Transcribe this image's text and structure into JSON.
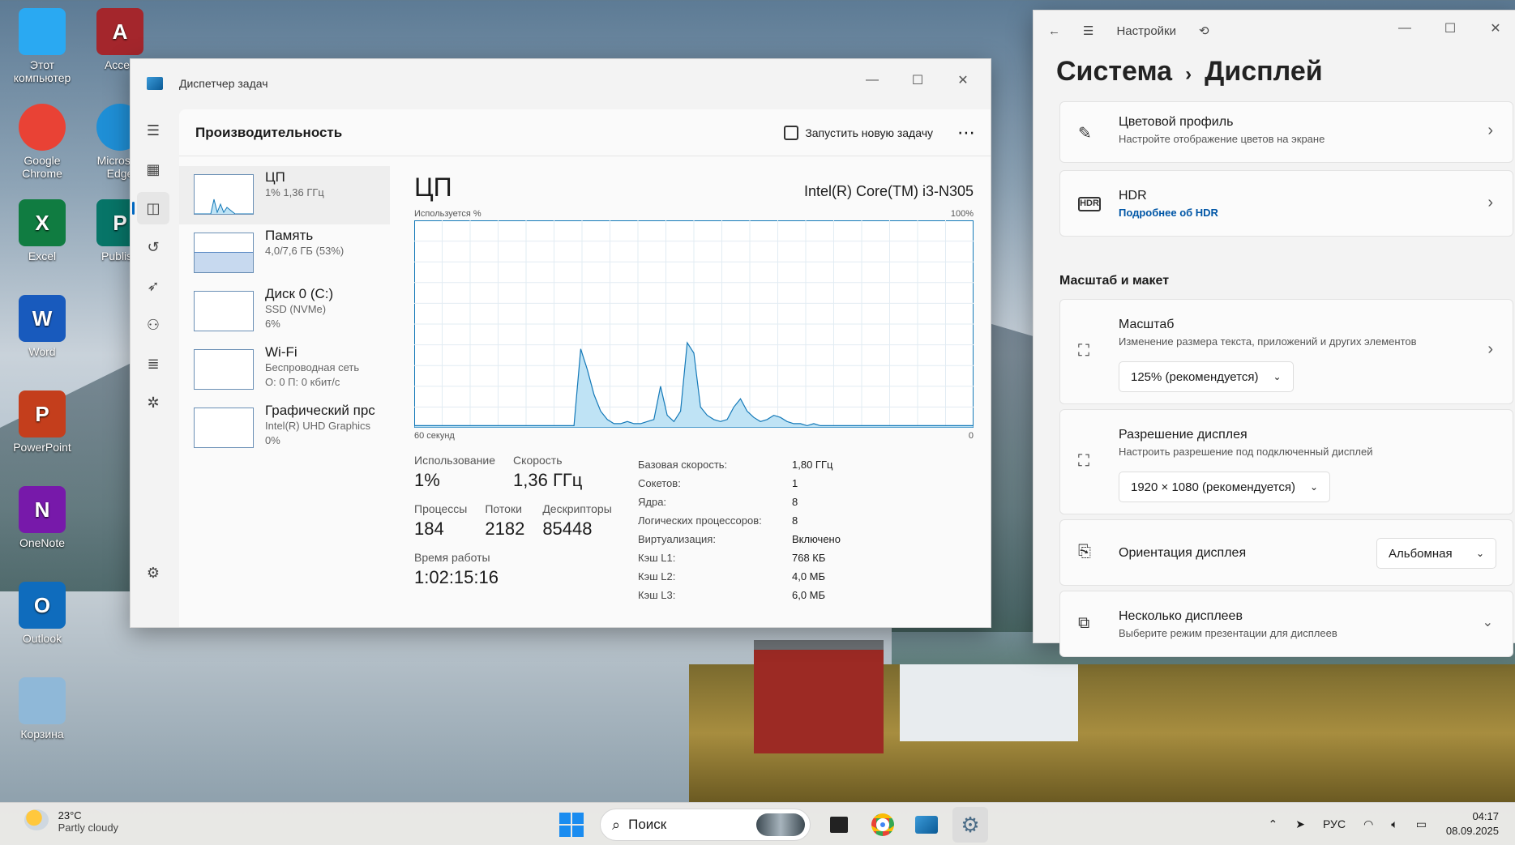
{
  "desktop": {
    "icons": [
      {
        "label": "Этот компьютер",
        "icon": "computer-icon",
        "color": "#2aa9f2"
      },
      {
        "label": "Acces",
        "icon": "access-icon",
        "color": "#a4262c"
      },
      {
        "label": "Google Chrome",
        "icon": "chrome-icon",
        "color": "#e94235"
      },
      {
        "label": "Microsoft Edge",
        "icon": "edge-icon",
        "color": "#1f8fd6"
      },
      {
        "label": "Excel",
        "icon": "excel-icon",
        "color": "#107c41"
      },
      {
        "label": "Publish",
        "icon": "publisher-icon",
        "color": "#077568"
      },
      {
        "label": "Word",
        "icon": "word-icon",
        "color": "#185abd"
      },
      {
        "label": "PowerPoint",
        "icon": "powerpoint-icon",
        "color": "#c43e1c"
      },
      {
        "label": "OneNote",
        "icon": "onenote-icon",
        "color": "#7719aa"
      },
      {
        "label": "Outlook",
        "icon": "outlook-icon",
        "color": "#0f6cbd"
      },
      {
        "label": "Корзина",
        "icon": "recycle-bin-icon",
        "color": "#8fb8d8"
      }
    ]
  },
  "taskmgr": {
    "title": "Диспетчер задач",
    "page": "Производительность",
    "run_task": "Запустить новую задачу",
    "more": "⋯",
    "perf_items": [
      {
        "name": "ЦП",
        "sub1": "1% 1,36 ГГц",
        "sub2": ""
      },
      {
        "name": "Память",
        "sub1": "4,0/7,6 ГБ (53%)",
        "sub2": ""
      },
      {
        "name": "Диск 0 (C:)",
        "sub1": "SSD (NVMe)",
        "sub2": "6%"
      },
      {
        "name": "Wi-Fi",
        "sub1": "Беспроводная сеть",
        "sub2": "О: 0 П: 0 кбит/с"
      },
      {
        "name": "Графический прс",
        "sub1": "Intel(R) UHD Graphics",
        "sub2": "0%"
      }
    ],
    "cpu": {
      "title": "ЦП",
      "model": "Intel(R) Core(TM) i3-N305",
      "graph_label": "Используется %",
      "graph_max": "100%",
      "graph_span": "60 секунд",
      "graph_min": "0",
      "stats": {
        "usage_label": "Использование",
        "usage": "1%",
        "speed_label": "Скорость",
        "speed": "1,36 ГГц",
        "proc_label": "Процессы",
        "proc": "184",
        "threads_label": "Потоки",
        "threads": "2182",
        "handles_label": "Дескрипторы",
        "handles": "85448",
        "uptime_label": "Время работы",
        "uptime": "1:02:15:16"
      },
      "specs": [
        {
          "k": "Базовая скорость:",
          "v": "1,80 ГГц"
        },
        {
          "k": "Сокетов:",
          "v": "1"
        },
        {
          "k": "Ядра:",
          "v": "8"
        },
        {
          "k": "Логических процессоров:",
          "v": "8"
        },
        {
          "k": "Виртуализация:",
          "v": "Включено"
        },
        {
          "k": "Кэш L1:",
          "v": "768 КБ"
        },
        {
          "k": "Кэш L2:",
          "v": "4,0 МБ"
        },
        {
          "k": "Кэш L3:",
          "v": "6,0 МБ"
        }
      ],
      "usage_history": [
        1,
        1,
        1,
        1,
        1,
        1,
        1,
        1,
        1,
        1,
        1,
        1,
        1,
        1,
        1,
        1,
        1,
        1,
        1,
        1,
        1,
        1,
        1,
        1,
        1,
        38,
        28,
        16,
        8,
        4,
        2,
        2,
        3,
        2,
        2,
        3,
        4,
        20,
        6,
        3,
        8,
        41,
        36,
        10,
        6,
        4,
        3,
        4,
        10,
        14,
        8,
        5,
        3,
        4,
        6,
        5,
        3,
        2,
        2,
        1,
        2,
        1,
        1,
        1,
        1,
        1,
        1,
        1,
        1,
        1,
        1,
        1,
        1,
        1,
        1,
        1,
        1,
        1,
        1,
        1,
        1,
        1,
        1,
        1,
        1
      ]
    }
  },
  "settings": {
    "app": "Настройки",
    "crumb_parent": "Система",
    "crumb_current": "Дисплей",
    "color_profile_title": "Цветовой профиль",
    "color_profile_sub": "Настройте отображение цветов на экране",
    "hdr_title": "HDR",
    "hdr_link": "Подробнее об HDR",
    "section": "Масштаб и макет",
    "scale_title": "Масштаб",
    "scale_sub": "Изменение размера текста, приложений и других элементов",
    "scale_value": "125% (рекомендуется)",
    "res_title": "Разрешение дисплея",
    "res_sub": "Настроить разрешение под подключенный дисплей",
    "res_value": "1920 × 1080 (рекомендуется)",
    "orient_title": "Ориентация дисплея",
    "orient_value": "Альбомная",
    "multi_title": "Несколько дисплеев",
    "multi_sub": "Выберите режим презентации для дисплеев"
  },
  "taskbar": {
    "temp": "23°C",
    "weather": "Partly cloudy",
    "search": "Поиск",
    "lang": "РУС",
    "time": "04:17",
    "date": "08.09.2025"
  }
}
